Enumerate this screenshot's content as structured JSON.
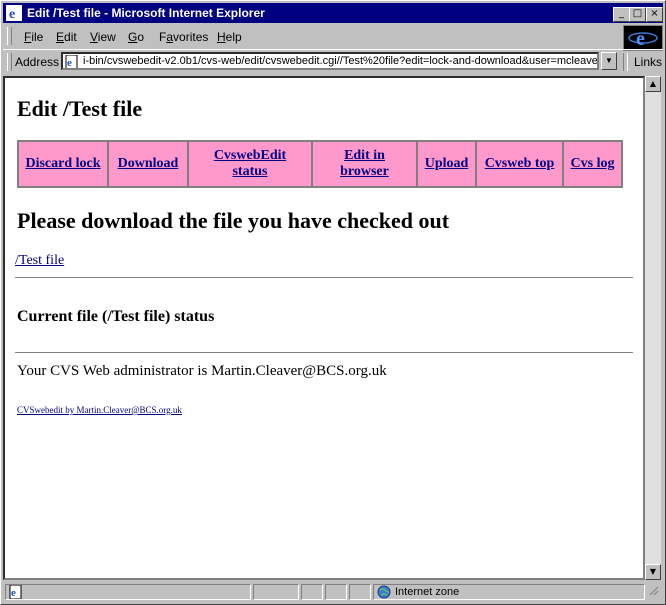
{
  "window": {
    "title": "Edit /Test file - Microsoft Internet Explorer"
  },
  "menubar": {
    "items": [
      {
        "label": "File",
        "key": "F"
      },
      {
        "label": "Edit",
        "key": "E"
      },
      {
        "label": "View",
        "key": "V"
      },
      {
        "label": "Go",
        "key": "G"
      },
      {
        "label": "Favorites",
        "key": "a"
      },
      {
        "label": "Help",
        "key": "H"
      }
    ]
  },
  "addressbar": {
    "label": "Address",
    "url": "i-bin/cvswebedit-v2.0b1/cvs-web/edit/cvswebedit.cgi//Test%20file?edit=lock-and-download&user=mcleaver",
    "links_label": "Links"
  },
  "page": {
    "title": "Edit /Test file",
    "nav": [
      {
        "label": "Discard lock"
      },
      {
        "label": "Download"
      },
      {
        "label": "CvswebEdit status"
      },
      {
        "label": "Edit in browser"
      },
      {
        "label": "Upload"
      },
      {
        "label": "Cvsweb top"
      },
      {
        "label": "Cvs log"
      }
    ],
    "download_heading": "Please download the file you have checked out",
    "file_link": "/Test file",
    "status_heading": "Current file (/Test file) status",
    "admin_text": "Your CVS Web administrator is Martin.Cleaver@BCS.org.uk",
    "footer_link": "CVSwebedit by Martin.Cleaver@BCS.org.uk"
  },
  "statusbar": {
    "zone": "Internet zone"
  },
  "colors": {
    "titlebar": "#000080",
    "nav_bg": "#ff99cc",
    "link": "#000080"
  }
}
